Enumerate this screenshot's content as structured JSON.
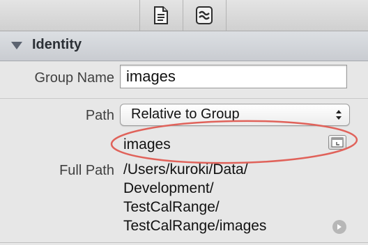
{
  "toolbar": {
    "file_inspector_icon": "document-icon",
    "quick_help_icon": "quick-help-icon"
  },
  "section": {
    "title": "Identity"
  },
  "identity": {
    "group_name_label": "Group Name",
    "group_name_value": "images",
    "path_label": "Path",
    "path_selected": "Relative to Group",
    "path_value": "images",
    "full_path_label": "Full Path",
    "full_path_lines": [
      "/Users/kuroki/Data/",
      "Development/",
      "TestCalRange/",
      "TestCalRange/images"
    ]
  },
  "annotation": {
    "color": "#e0625a"
  }
}
